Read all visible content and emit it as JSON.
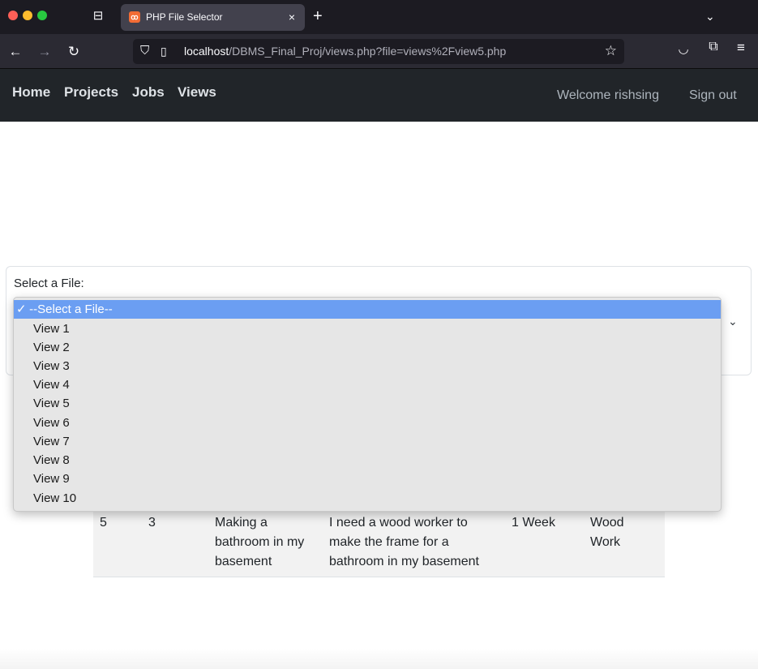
{
  "browser": {
    "tab_title": "PHP File Selector",
    "tab_close_glyph": "×",
    "new_tab_glyph": "+",
    "url_host": "localhost",
    "url_path": "/DBMS_Final_Proj/views.php?file=views%2Fview5.php",
    "icons": [
      "tab-overview-icon",
      "tab-favicon-icon",
      "back-arrow-icon",
      "forward-arrow-icon",
      "reload-icon",
      "shield-icon",
      "page-icon",
      "bookmark-star-icon",
      "pocket-icon",
      "extensions-icon",
      "hamburger-menu-icon",
      "tabs-list-chevron-icon"
    ]
  },
  "header": {
    "links": {
      "home": "Home",
      "projects": "Projects",
      "jobs": "Jobs",
      "views": "Views"
    },
    "welcome": "Welcome rishsing",
    "signout": "Sign out"
  },
  "form": {
    "label": "Select a File:",
    "selected_value": "--Select a File--",
    "options": [
      "--Select a File--",
      "View 1",
      "View 2",
      "View 3",
      "View 4",
      "View 5",
      "View 6",
      "View 7",
      "View 8",
      "View 9",
      "View 10"
    ]
  },
  "table": {
    "row": {
      "c1": "5",
      "c2": "3",
      "c3": "Making a bathroom in my basement",
      "c4": "I need a wood worker to make the frame for a bathroom in my basement",
      "c5": "1 Week",
      "c6": "Wood Work"
    }
  },
  "colors": {
    "site_header": "#212529",
    "selected_option": "#6b9ef2",
    "dropdown_bg": "#e6e6e6"
  }
}
